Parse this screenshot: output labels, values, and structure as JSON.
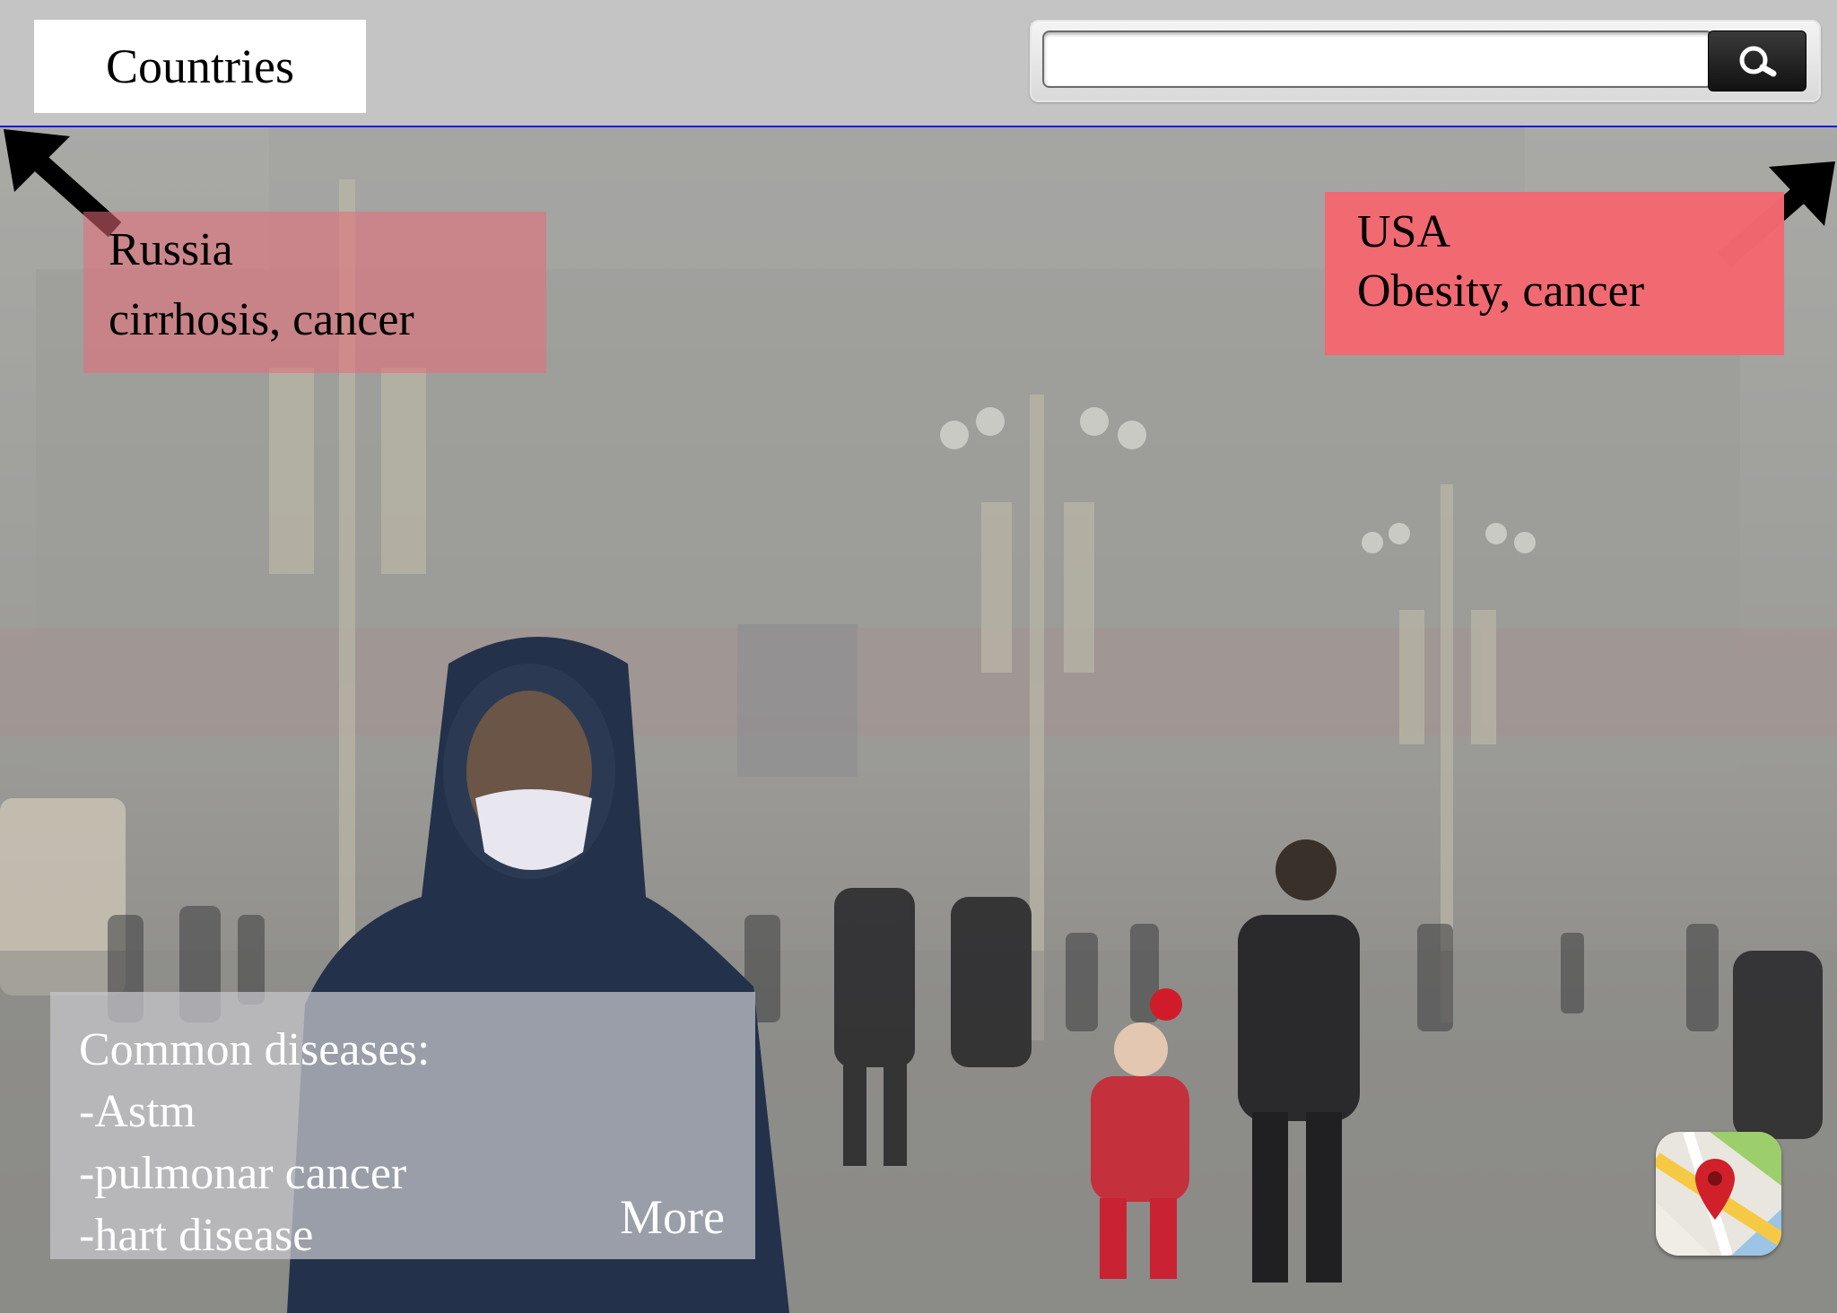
{
  "topbar": {
    "countries_label": "Countries",
    "search": {
      "value": "",
      "placeholder": ""
    },
    "divider_color": "#1a1ae0"
  },
  "cards": {
    "russia": {
      "country": "Russia",
      "diseases": "cirrhosis, cancer"
    },
    "usa": {
      "country": "USA",
      "diseases": "Obesity, cancer"
    }
  },
  "common_diseases": {
    "heading": "Common diseases:",
    "items": [
      "-Astm",
      "-pulmonar cancer",
      "-hart disease"
    ],
    "more_label": "More"
  },
  "icons": {
    "search": "search-icon",
    "maps": "maps-app-icon",
    "arrow_left": "arrow-up-left-icon",
    "arrow_right": "arrow-up-right-icon"
  },
  "colors": {
    "card_red": "#f06e76",
    "topbar_bg": "#c4c4c4"
  }
}
